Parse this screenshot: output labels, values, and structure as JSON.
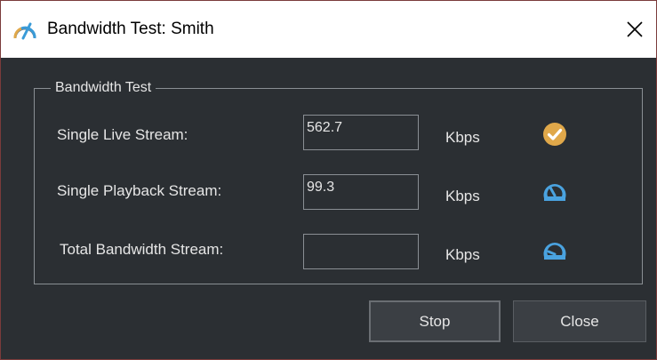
{
  "window": {
    "title": "Bandwidth Test: Smith",
    "app_icon": "speedometer-icon",
    "close_icon": "close-icon"
  },
  "group": {
    "title": "Bandwidth Test",
    "rows": [
      {
        "label": "Single Live Stream:",
        "value": "562.7",
        "unit": "Kbps",
        "status_icon": "checkmark-circle-icon"
      },
      {
        "label": "Single Playback Stream:",
        "value": "99.3",
        "unit": "Kbps",
        "status_icon": "gauge-icon"
      },
      {
        "label": "Total Bandwidth Stream:",
        "value": "",
        "unit": "Kbps",
        "status_icon": "gauge-icon"
      }
    ]
  },
  "buttons": {
    "stop": "Stop",
    "close": "Close"
  },
  "colors": {
    "background": "#2b2f33",
    "text": "#e6e6e6",
    "check_icon": "#e0a84a",
    "gauge_icon": "#4aa3e0"
  }
}
